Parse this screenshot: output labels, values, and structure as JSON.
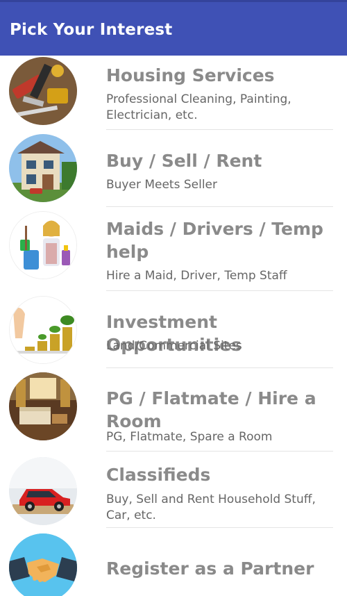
{
  "appbar": {
    "title": "Pick Your Interest"
  },
  "colors": {
    "appbar": "#3f51b5",
    "title_text": "#8a8a8a",
    "subtitle_text": "#666666"
  },
  "items": [
    {
      "title": "Housing Services",
      "subtitle": "Professional Cleaning, Painting, Electrician, etc.",
      "icon": "tools-image"
    },
    {
      "title": "Buy / Sell / Rent",
      "subtitle": "Buyer Meets Seller",
      "icon": "house-image"
    },
    {
      "title": "Maids / Drivers / Temp help",
      "subtitle": "Hire a Maid, Driver, Temp Staff",
      "icon": "maid-image"
    },
    {
      "title": "Investment Opportunities",
      "subtitle": "Land/Commercial Sites",
      "icon": "coins-plant-image"
    },
    {
      "title": "PG / Flatmate / Hire a Room",
      "subtitle": "PG, Flatmate, Spare a Room",
      "icon": "room-image"
    },
    {
      "title": "Classifieds",
      "subtitle": "Buy, Sell and Rent Household Stuff, Car, etc.",
      "icon": "car-image"
    },
    {
      "title": "Register as a Partner",
      "subtitle": "",
      "icon": "handshake-image"
    }
  ]
}
